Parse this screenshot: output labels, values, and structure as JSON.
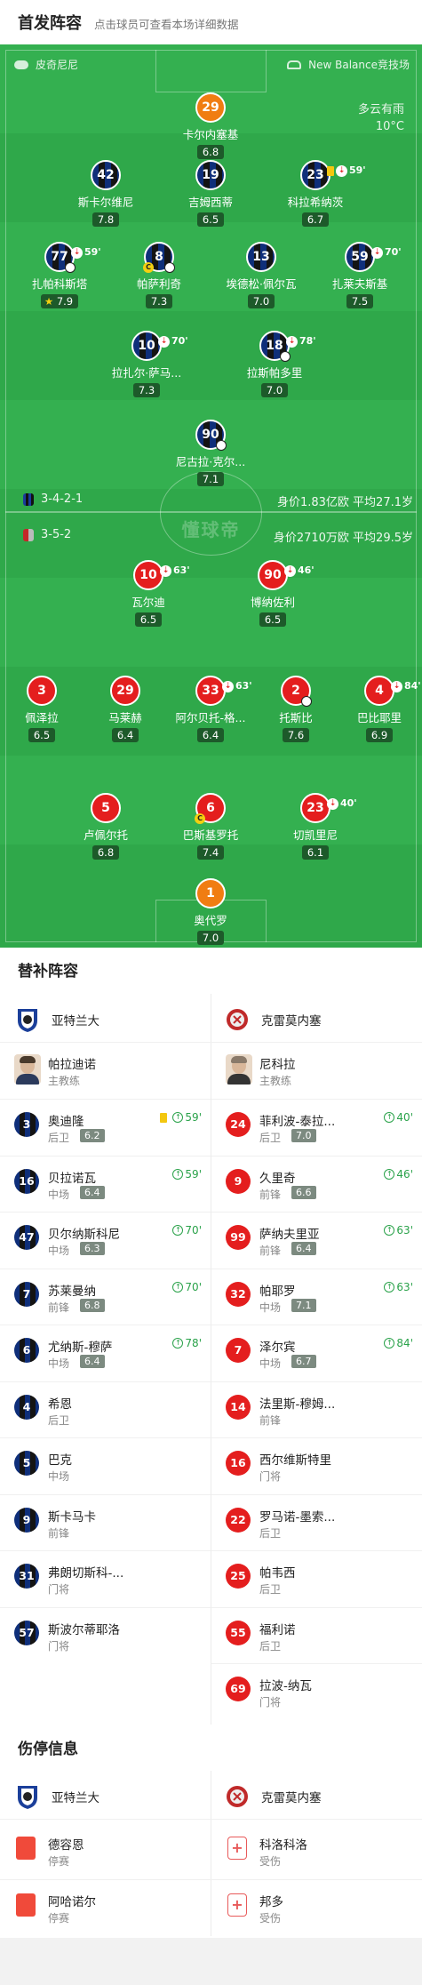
{
  "header": {
    "title": "首发阵容",
    "subtitle": "点击球员可查看本场详细数据"
  },
  "pitch": {
    "home_team": "皮奇尼尼",
    "venue": "New Balance竞技场",
    "weather": "多云有雨",
    "temperature": "10°C",
    "watermark": "懂球帝",
    "home_formation": "3-4-2-1",
    "away_formation": "3-5-2",
    "home_stats": "身价1.83亿欧  平均27.1岁",
    "away_stats": "身价2710万欧  平均29.5岁"
  },
  "players": [
    {
      "id": "p1",
      "num": "29",
      "name": "卡尔内塞基",
      "rating": "6.8",
      "kit": "orange"
    },
    {
      "id": "p2",
      "num": "42",
      "name": "斯卡尔维尼",
      "rating": "7.8",
      "kit": "blue"
    },
    {
      "id": "p3",
      "num": "19",
      "name": "吉姆西蒂",
      "rating": "6.5",
      "kit": "blue"
    },
    {
      "id": "p4",
      "num": "23",
      "name": "科拉希纳茨",
      "rating": "6.7",
      "kit": "blue",
      "event": "59'",
      "card": "yellow"
    },
    {
      "id": "p5",
      "num": "77",
      "name": "扎帕科斯塔",
      "rating": "7.9",
      "kit": "blue",
      "event": "59'",
      "star": true
    },
    {
      "id": "p6",
      "num": "8",
      "name": "帕萨利奇",
      "rating": "7.3",
      "kit": "blue",
      "captain": "C"
    },
    {
      "id": "p7",
      "num": "13",
      "name": "埃德松·佩尔瓦",
      "rating": "7.0",
      "kit": "blue"
    },
    {
      "id": "p8",
      "num": "59",
      "name": "扎莱夫斯基",
      "rating": "7.5",
      "kit": "blue",
      "event": "70'"
    },
    {
      "id": "p9",
      "num": "10",
      "name": "拉扎尔·萨马...",
      "rating": "7.3",
      "kit": "blue",
      "event": "70'"
    },
    {
      "id": "p10",
      "num": "18",
      "name": "拉斯帕多里",
      "rating": "7.0",
      "kit": "blue",
      "event": "78'"
    },
    {
      "id": "p11",
      "num": "90",
      "name": "尼古拉·克尔...",
      "rating": "7.1",
      "kit": "blue",
      "goal": true
    },
    {
      "id": "a1",
      "num": "10",
      "name": "瓦尔迪",
      "rating": "6.5",
      "kit": "red",
      "event": "63'"
    },
    {
      "id": "a2",
      "num": "90",
      "name": "博纳佐利",
      "rating": "6.5",
      "kit": "red",
      "event": "46'"
    },
    {
      "id": "a3",
      "num": "3",
      "name": "佩泽拉",
      "rating": "6.5",
      "kit": "red"
    },
    {
      "id": "a4",
      "num": "29",
      "name": "马莱赫",
      "rating": "6.4",
      "kit": "red"
    },
    {
      "id": "a5",
      "num": "33",
      "name": "阿尔贝托-格...",
      "rating": "6.4",
      "kit": "red",
      "event": "63'"
    },
    {
      "id": "a6",
      "num": "2",
      "name": "托斯比",
      "rating": "7.6",
      "kit": "red",
      "goal": true
    },
    {
      "id": "a7",
      "num": "4",
      "name": "巴比耶里",
      "rating": "6.9",
      "kit": "red",
      "event": "84'"
    },
    {
      "id": "a8",
      "num": "5",
      "name": "卢佩尔托",
      "rating": "6.8",
      "kit": "red"
    },
    {
      "id": "a9",
      "num": "6",
      "name": "巴斯基罗托",
      "rating": "7.4",
      "kit": "red",
      "captain": "C"
    },
    {
      "id": "a10",
      "num": "23",
      "name": "切凯里尼",
      "rating": "6.1",
      "kit": "red",
      "event": "40'"
    },
    {
      "id": "a11",
      "num": "1",
      "name": "奥代罗",
      "rating": "7.0",
      "kit": "orange"
    }
  ],
  "subs": {
    "title": "替补阵容",
    "home_team": "亚特兰大",
    "away_team": "克雷莫内塞",
    "home_coach": {
      "name": "帕拉迪诺",
      "role": "主教练"
    },
    "away_coach": {
      "name": "尼科拉",
      "role": "主教练"
    },
    "home": [
      {
        "num": "3",
        "name": "奥迪隆",
        "pos": "后卫",
        "rating": "6.2",
        "event": "59'",
        "card": "yellow"
      },
      {
        "num": "16",
        "name": "贝拉诺瓦",
        "pos": "中场",
        "rating": "6.4",
        "event": "59'"
      },
      {
        "num": "47",
        "name": "贝尔纳斯科尼",
        "pos": "中场",
        "rating": "6.3",
        "event": "70'"
      },
      {
        "num": "7",
        "name": "苏莱曼纳",
        "pos": "前锋",
        "rating": "6.8",
        "event": "70'"
      },
      {
        "num": "6",
        "name": "尤纳斯-穆萨",
        "pos": "中场",
        "rating": "6.4",
        "event": "78'"
      },
      {
        "num": "4",
        "name": "希恩",
        "pos": "后卫"
      },
      {
        "num": "5",
        "name": "巴克",
        "pos": "中场"
      },
      {
        "num": "9",
        "name": "斯卡马卡",
        "pos": "前锋"
      },
      {
        "num": "31",
        "name": "弗朗切斯科-...",
        "pos": "门将"
      },
      {
        "num": "57",
        "name": "斯波尔蒂耶洛",
        "pos": "门将"
      }
    ],
    "away": [
      {
        "num": "24",
        "name": "菲利波-泰拉...",
        "pos": "后卫",
        "rating": "7.0",
        "event": "40'"
      },
      {
        "num": "9",
        "name": "久里奇",
        "pos": "前锋",
        "rating": "6.6",
        "event": "46'"
      },
      {
        "num": "99",
        "name": "萨纳夫里亚",
        "pos": "前锋",
        "rating": "6.4",
        "event": "63'"
      },
      {
        "num": "32",
        "name": "帕耶罗",
        "pos": "中场",
        "rating": "7.1",
        "event": "63'"
      },
      {
        "num": "7",
        "name": "泽尔宾",
        "pos": "中场",
        "rating": "6.7",
        "event": "84'"
      },
      {
        "num": "14",
        "name": "法里斯-穆姆...",
        "pos": "前锋"
      },
      {
        "num": "16",
        "name": "西尔维斯特里",
        "pos": "门将"
      },
      {
        "num": "22",
        "name": "罗马诺-墨索...",
        "pos": "后卫"
      },
      {
        "num": "25",
        "name": "帕韦西",
        "pos": "后卫"
      },
      {
        "num": "55",
        "name": "福利诺",
        "pos": "后卫"
      },
      {
        "num": "69",
        "name": "拉波-纳瓦",
        "pos": "门将"
      }
    ]
  },
  "injuries": {
    "title": "伤停信息",
    "home_team": "亚特兰大",
    "away_team": "克雷莫内塞",
    "home": [
      {
        "name": "德容恩",
        "status": "停赛",
        "icon": "red-card-icon"
      },
      {
        "name": "阿哈诺尔",
        "status": "停赛",
        "icon": "red-card-icon"
      }
    ],
    "away": [
      {
        "name": "科洛科洛",
        "status": "受伤",
        "icon": "medical-kit-icon"
      },
      {
        "name": "邦多",
        "status": "受伤",
        "icon": "medical-kit-icon"
      }
    ]
  }
}
